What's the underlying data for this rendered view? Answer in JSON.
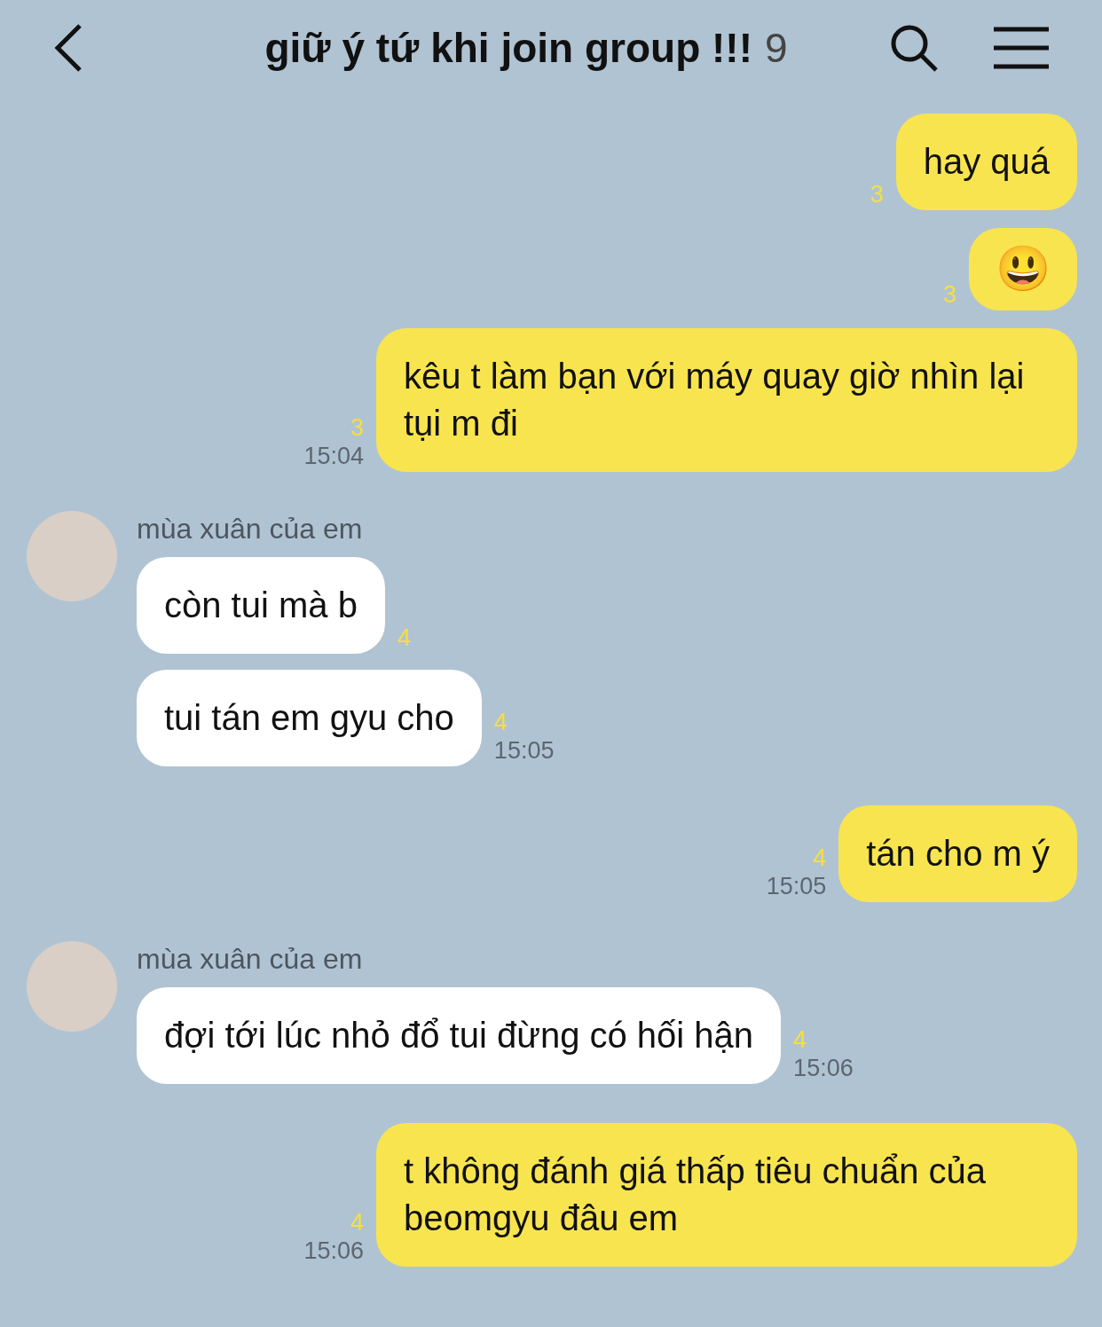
{
  "header": {
    "title": "giữ ý tứ khi join group !!!",
    "member_count": "9"
  },
  "messages": [
    {
      "kind": "mine",
      "text": "hay quá",
      "unread": "3"
    },
    {
      "kind": "mine-emoji",
      "text": "😃",
      "unread": "3"
    },
    {
      "kind": "mine",
      "text": "kêu t làm bạn với máy quay giờ nhìn lại tụi m đi",
      "unread": "3",
      "time": "15:04"
    },
    {
      "kind": "theirs",
      "sender": "mùa xuân của em",
      "bubbles": [
        {
          "text": "còn tui mà b",
          "unread": "4"
        },
        {
          "text": "tui tán em gyu cho",
          "unread": "4",
          "time": "15:05"
        }
      ]
    },
    {
      "kind": "mine",
      "text": "tán cho m ý",
      "unread": "4",
      "time": "15:05"
    },
    {
      "kind": "theirs",
      "sender": "mùa xuân của em",
      "bubbles": [
        {
          "text": "đợi tới lúc nhỏ đổ tui đừng có hối hận",
          "unread": "4",
          "time": "15:06"
        }
      ]
    },
    {
      "kind": "mine",
      "text": "t không đánh giá thấp tiêu chuẩn của beomgyu đâu em",
      "unread": "4",
      "time": "15:06"
    }
  ]
}
